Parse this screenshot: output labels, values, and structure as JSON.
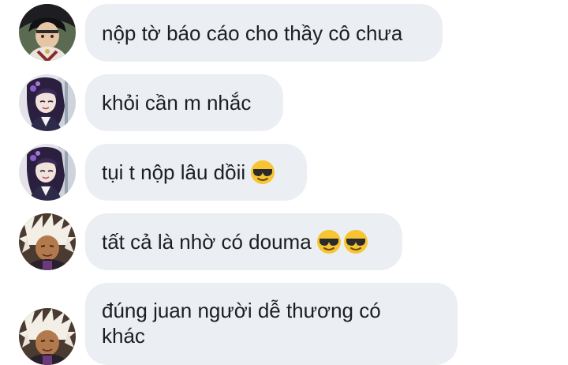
{
  "messages": [
    {
      "text": "nộp tờ báo cáo cho thầy cô chưa",
      "avatar": "avatar-boy-dark-hair-icon",
      "emoji": []
    },
    {
      "text": "khỏi cần m nhắc",
      "avatar": "avatar-girl-purple-hair-icon",
      "emoji": []
    },
    {
      "text": "tụi t nộp lâu dồii",
      "avatar": "avatar-girl-purple-hair-icon",
      "emoji": [
        "sunglasses-face-emoji"
      ]
    },
    {
      "text": "tất cả là nhờ có douma",
      "avatar": "avatar-boy-dreadlocks-icon",
      "emoji": [
        "sunglasses-face-emoji",
        "sunglasses-face-emoji"
      ]
    },
    {
      "text": "đúng juan người dễ thương có khác",
      "avatar": "avatar-boy-dreadlocks-icon",
      "emoji": []
    }
  ],
  "colors": {
    "bubble": "#ebeef3",
    "text": "#1c1e21",
    "emoji_face": "#f7c531",
    "emoji_glasses": "#2b2b2b"
  }
}
